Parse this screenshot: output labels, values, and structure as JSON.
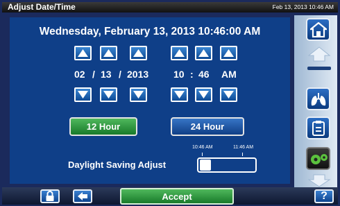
{
  "title_bar": {
    "title": "Adjust Date/Time",
    "datetime": "Feb 13, 2013 10:46 AM"
  },
  "main": {
    "full_date": "Wednesday, February 13, 2013 10:46:00 AM",
    "fields": {
      "month": "02",
      "day": "13",
      "year": "2013",
      "hour": "10",
      "minute": "46",
      "ampm": "AM",
      "date_separator": "/",
      "time_separator": ":"
    },
    "format_buttons": {
      "hour12": "12 Hour",
      "hour24": "24 Hour",
      "selected": "12 Hour"
    },
    "dst": {
      "label": "Daylight Saving Adjust",
      "left_label": "10:46 AM",
      "right_label": "11:46 AM"
    }
  },
  "sidebar": {
    "icons": [
      "home-icon",
      "up-arrow-icon",
      "lungs-icon",
      "clipboard-icon",
      "gears-icon",
      "down-arrow-icon"
    ]
  },
  "bottom_bar": {
    "accept_label": "Accept",
    "help_label": "?"
  },
  "colors": {
    "panel": "#0f3f88",
    "frame": "#1b2a5c",
    "accent_green": "#2e9a3c",
    "button_blue": "#1a5fb0"
  }
}
